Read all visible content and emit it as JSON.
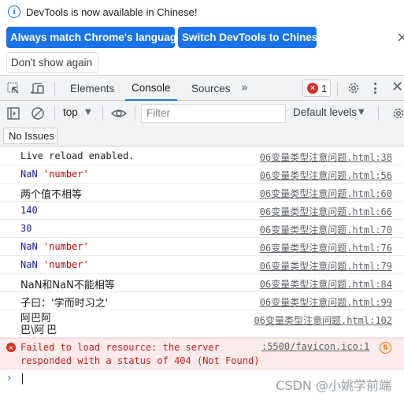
{
  "infobar": {
    "message": "DevTools is now available in Chinese!",
    "info_icon": "i",
    "buttons": {
      "match": "Always match Chrome's language",
      "switch": "Switch DevTools to Chinese",
      "dont_show": "Don't show again"
    },
    "close_glyph": "×"
  },
  "tabbar": {
    "tabs": [
      {
        "label": "Elements",
        "active": false
      },
      {
        "label": "Console",
        "active": true
      },
      {
        "label": "Sources",
        "active": false
      }
    ],
    "more_glyph": "»",
    "error_count": "1",
    "error_glyph": "×",
    "close_glyph": "✕"
  },
  "console_toolbar": {
    "context": "top",
    "dropdown_glyph": "▼",
    "filter_placeholder": "Filter",
    "levels": "Default levels"
  },
  "issues": {
    "label": "No Issues"
  },
  "messages": [
    {
      "parts": [
        {
          "text": "Live reload enabled.",
          "kind": "plain"
        }
      ],
      "source": "06变量类型注意问题.html:38"
    },
    {
      "parts": [
        {
          "text": "NaN",
          "kind": "num"
        },
        {
          "text": " ",
          "kind": "plain"
        },
        {
          "text": "'number'",
          "kind": "str"
        }
      ],
      "source": "06变量类型注意问题.html:56"
    },
    {
      "parts": [
        {
          "text": "两个值不相等",
          "kind": "cjk"
        }
      ],
      "source": "06变量类型注意问题.html:60"
    },
    {
      "parts": [
        {
          "text": "140",
          "kind": "num"
        }
      ],
      "source": "06变量类型注意问题.html:66"
    },
    {
      "parts": [
        {
          "text": "30",
          "kind": "num"
        }
      ],
      "source": "06变量类型注意问题.html:70"
    },
    {
      "parts": [
        {
          "text": "NaN",
          "kind": "num"
        },
        {
          "text": " ",
          "kind": "plain"
        },
        {
          "text": "'number'",
          "kind": "str"
        }
      ],
      "source": "06变量类型注意问题.html:76"
    },
    {
      "parts": [
        {
          "text": "NaN",
          "kind": "num"
        },
        {
          "text": " ",
          "kind": "plain"
        },
        {
          "text": "'number'",
          "kind": "str"
        }
      ],
      "source": "06变量类型注意问题.html:79"
    },
    {
      "parts": [
        {
          "text": "NaN和NaN不能相等",
          "kind": "cjk"
        }
      ],
      "source": "06变量类型注意问题.html:84"
    },
    {
      "parts": [
        {
          "text": "子曰：'学而时习之'",
          "kind": "cjk"
        }
      ],
      "source": "06变量类型注意问题.html:99"
    },
    {
      "parts": [
        {
          "text": "阿巴阿\n巴\\阿\t巴",
          "kind": "cjk-multi"
        }
      ],
      "source": "06变量类型注意问题.html:102"
    }
  ],
  "error": {
    "text": "Failed to load resource: the server\nresponded with a status of 404 (Not Found)",
    "source": ":5500/favicon.ico:1",
    "icon_glyph": "×",
    "network_glyph": "⇅"
  },
  "prompt": {
    "glyph": "›"
  },
  "watermark": "CSDN @小姚学前端"
}
